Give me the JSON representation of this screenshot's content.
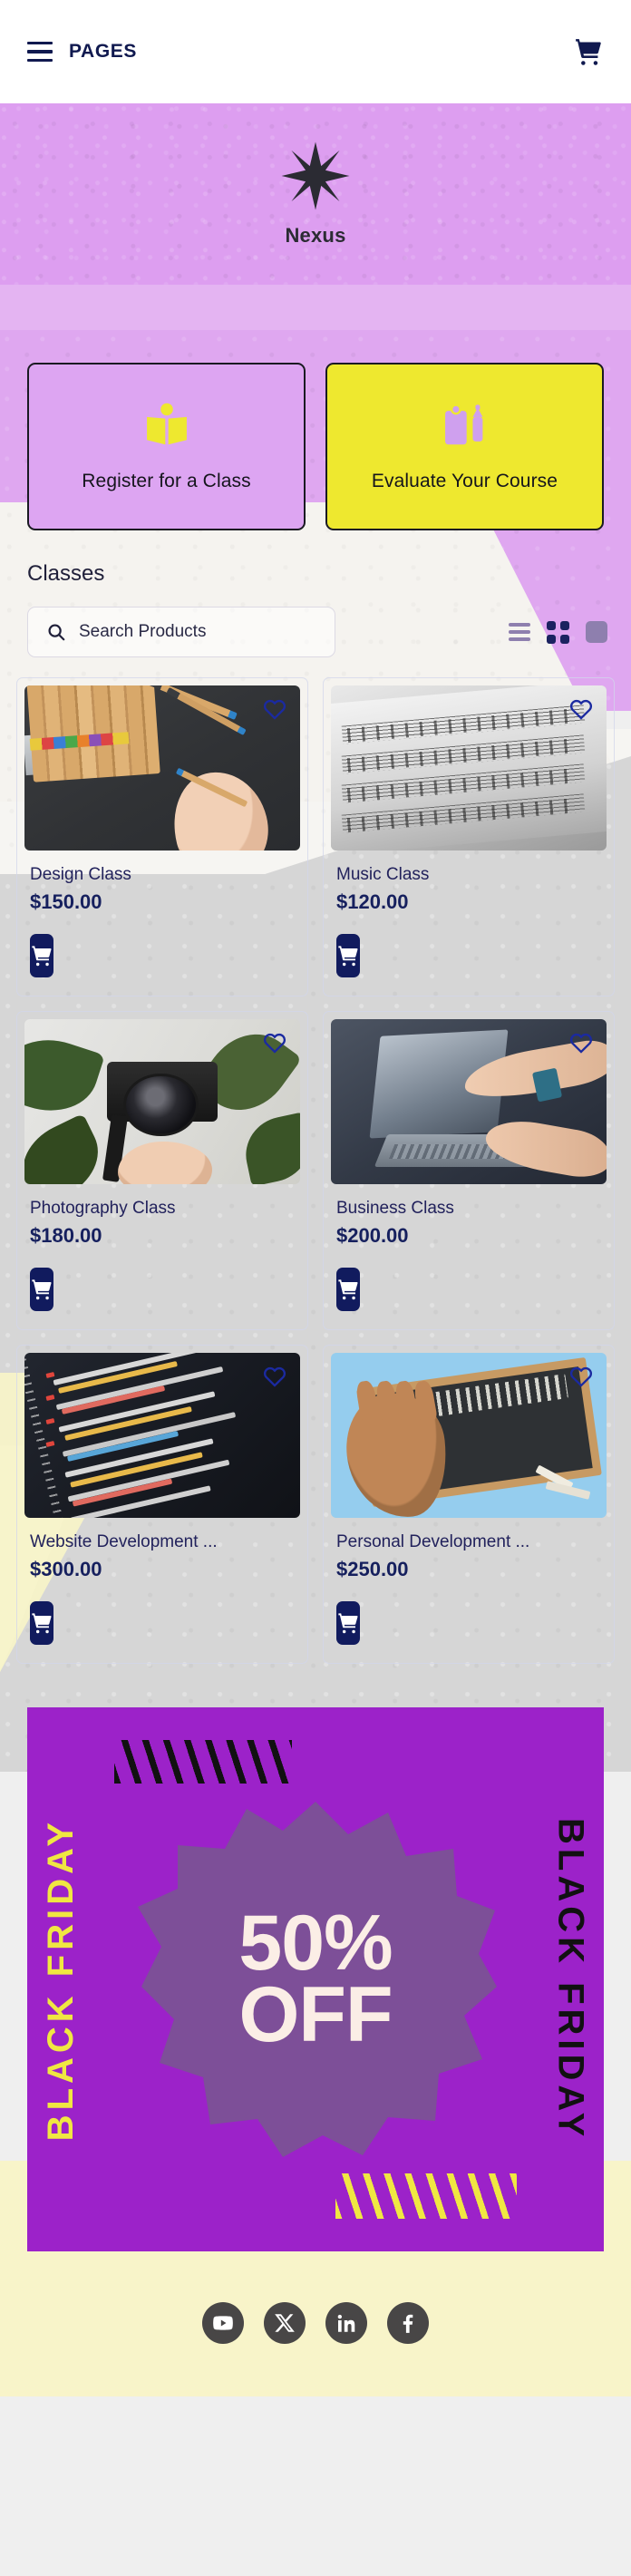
{
  "header": {
    "menu_label": "PAGES",
    "menu_icon": "hamburger-icon",
    "cart_icon": "shopping-cart-icon"
  },
  "hero": {
    "logo_icon": "eight-point-star-icon",
    "brand": "Nexus",
    "background_color": "#dd9ef0"
  },
  "quick_actions": [
    {
      "label": "Register for a Class",
      "icon": "open-book-icon",
      "bg": "#dda5f2",
      "icon_color": "#eee82f"
    },
    {
      "label": "Evaluate Your Course",
      "icon": "clipboard-pen-icon",
      "bg": "#eee82f",
      "icon_color": "#cfa0ee"
    }
  ],
  "section": {
    "title": "Classes"
  },
  "search": {
    "placeholder": "Search Products",
    "value": "",
    "icon": "magnifier-icon"
  },
  "view_toggle": {
    "options": [
      {
        "name": "list-view",
        "active": false
      },
      {
        "name": "grid-view",
        "active": true
      },
      {
        "name": "single-view",
        "active": false
      }
    ],
    "active_color": "#1b2260",
    "inactive_color": "#8e7fae"
  },
  "products": [
    {
      "name": "Design Class",
      "price": "$150.00",
      "favorite_icon": "heart-outline-icon",
      "cart_icon": "shopping-cart-icon",
      "art": "art-design"
    },
    {
      "name": "Music Class",
      "price": "$120.00",
      "favorite_icon": "heart-outline-icon",
      "cart_icon": "shopping-cart-icon",
      "art": "art-music"
    },
    {
      "name": "Photography Class",
      "price": "$180.00",
      "favorite_icon": "heart-outline-icon",
      "cart_icon": "shopping-cart-icon",
      "art": "art-photo"
    },
    {
      "name": "Business Class",
      "price": "$200.00",
      "favorite_icon": "heart-outline-icon",
      "cart_icon": "shopping-cart-icon",
      "art": "art-biz"
    },
    {
      "name": "Website Development ...",
      "price": "$300.00",
      "favorite_icon": "heart-outline-icon",
      "cart_icon": "shopping-cart-icon",
      "art": "art-code"
    },
    {
      "name": "Personal Development ...",
      "price": "$250.00",
      "favorite_icon": "heart-outline-icon",
      "cart_icon": "shopping-cart-icon",
      "art": "art-chalk"
    }
  ],
  "promo_banner": {
    "left_text": "BLACK FRIDAY",
    "right_text": "BLACK FRIDAY",
    "discount_line1": "50%",
    "discount_line2": "OFF",
    "bg_color": "#9c22c9",
    "badge_color": "#7d4f98",
    "accent_yellow": "#f0e742"
  },
  "footer": {
    "socials": [
      {
        "name": "youtube-icon",
        "label": "YouTube"
      },
      {
        "name": "x-twitter-icon",
        "label": "X"
      },
      {
        "name": "linkedin-icon",
        "label": "LinkedIn"
      },
      {
        "name": "facebook-icon",
        "label": "Facebook"
      }
    ],
    "bg_color": "#f8f4c9"
  }
}
